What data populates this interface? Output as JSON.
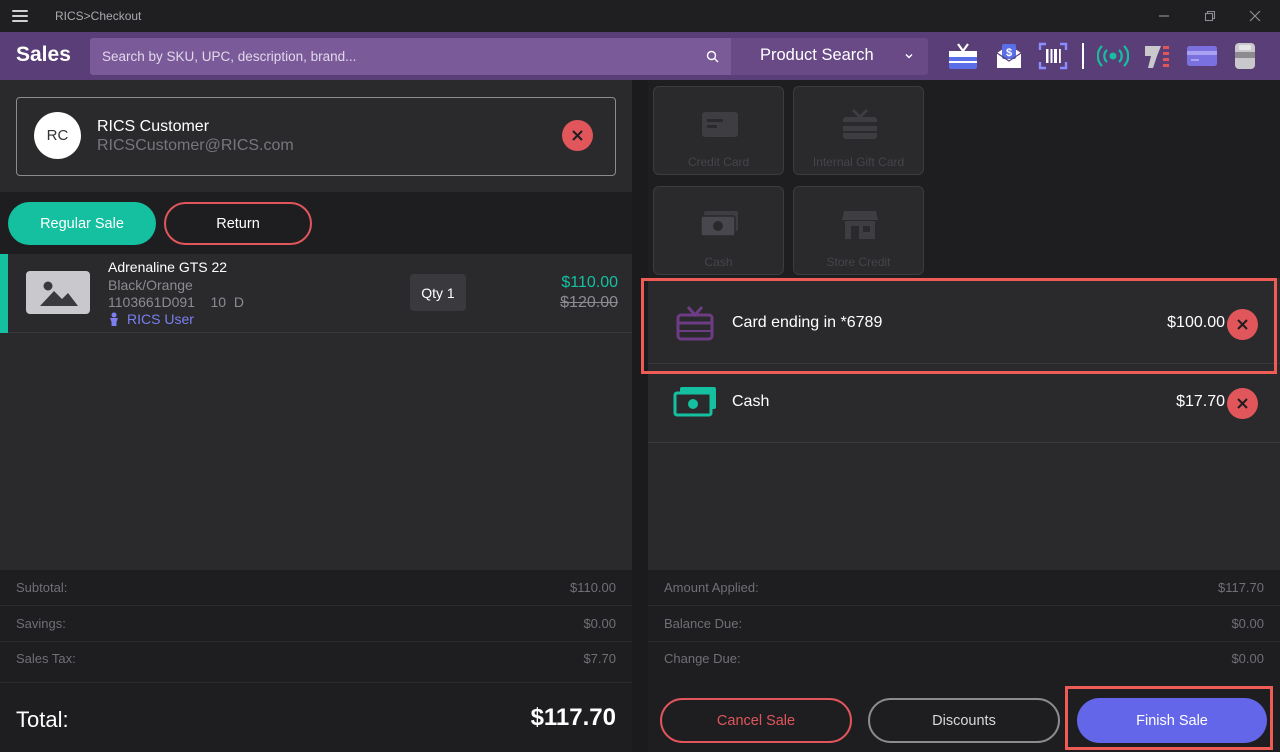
{
  "window": {
    "title": "RICS>Checkout"
  },
  "header": {
    "app_title": "Sales",
    "search_placeholder": "Search by SKU, UPC, description, brand...",
    "search_mode": "Product Search",
    "icons": [
      "gift-card-icon",
      "email-receipt-icon",
      "barcode-scan-icon",
      "wireless-signal-icon",
      "scanner-icon",
      "credit-card-icon",
      "card-reader-icon"
    ]
  },
  "customer": {
    "initials": "RC",
    "name": "RICS Customer",
    "email": "RICSCustomer@RICS.com"
  },
  "sale_mode": {
    "regular_label": "Regular Sale",
    "return_label": "Return"
  },
  "items": [
    {
      "name": "Adrenaline GTS 22",
      "color": "Black/Orange",
      "sku_size": "1103661D091    10  D",
      "user": "RICS User",
      "qty_label": "Qty 1",
      "price": "$110.00",
      "original_price": "$120.00"
    }
  ],
  "totals": {
    "subtotal_label": "Subtotal:",
    "subtotal": "$110.00",
    "savings_label": "Savings:",
    "savings": "$0.00",
    "tax_label": "Sales Tax:",
    "tax": "$7.70",
    "total_label": "Total:",
    "total": "$117.70"
  },
  "tenders": [
    {
      "label": "Credit Card",
      "icon": "credit-card-icon"
    },
    {
      "label": "Internal Gift Card",
      "icon": "gift-card-icon"
    },
    {
      "label": "Cash",
      "icon": "cash-icon"
    },
    {
      "label": "Store Credit",
      "icon": "store-icon"
    }
  ],
  "payments": [
    {
      "label": "Card ending in *6789",
      "amount": "$100.00",
      "icon": "gift-card-icon"
    },
    {
      "label": "Cash",
      "amount": "$17.70",
      "icon": "cash-icon"
    }
  ],
  "payment_totals": {
    "applied_label": "Amount Applied:",
    "applied": "$117.70",
    "balance_label": "Balance Due:",
    "balance": "$0.00",
    "change_label": "Change Due:",
    "change": "$0.00"
  },
  "actions": {
    "cancel_label": "Cancel Sale",
    "discounts_label": "Discounts",
    "finish_label": "Finish Sale"
  },
  "colors": {
    "brand_purple": "#5a3e78",
    "accent_teal": "#14c0a0",
    "danger_red": "#e0565b",
    "finish_blue": "#6366e8"
  }
}
